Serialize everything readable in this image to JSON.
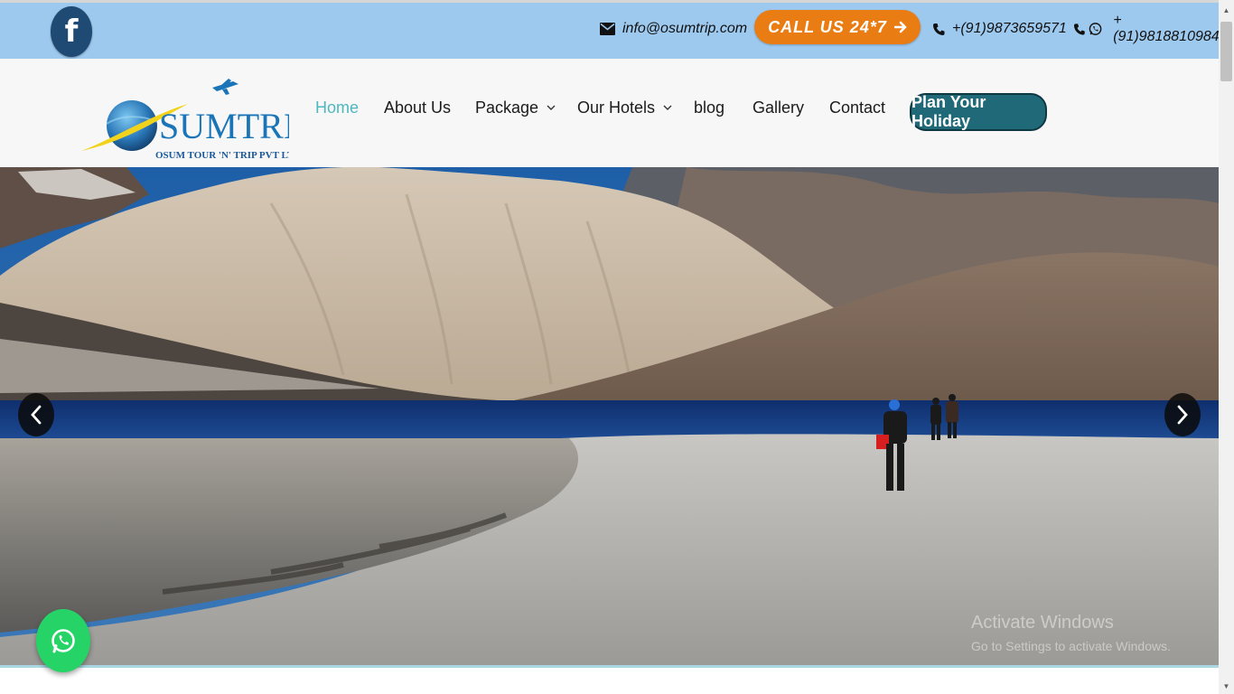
{
  "top_bar": {
    "facebook_label": "f",
    "email": "info@osumtrip.com",
    "call_label": "CALL US 24*7",
    "phone_1": "+(91)9873659571",
    "phone_2": "+(91)9818810984",
    "colors": {
      "bar": "#9ec9ef",
      "call_button": "#e97c12",
      "facebook": "#1f4a74"
    }
  },
  "header": {
    "logo_text": "SUMTRIP",
    "logo_subtext": "OSUM TOUR 'N' TRIP PVT LTD.",
    "nav": [
      "Home",
      "About Us",
      "Package",
      "Our Hotels",
      "blog",
      "Gallery",
      "Contact"
    ],
    "nav_active": "Home",
    "cta_label": "Plan Your Holiday",
    "colors": {
      "active_link": "#4fb7bf",
      "cta": "#1f6978"
    }
  },
  "hero": {
    "icons": [
      "chevron-left-icon",
      "chevron-right-icon"
    ],
    "watermark_title": "Activate Windows",
    "watermark_subtitle": "Go to Settings to activate Windows."
  },
  "whatsapp": {
    "icon": "whatsapp-icon",
    "color": "#25d366"
  }
}
